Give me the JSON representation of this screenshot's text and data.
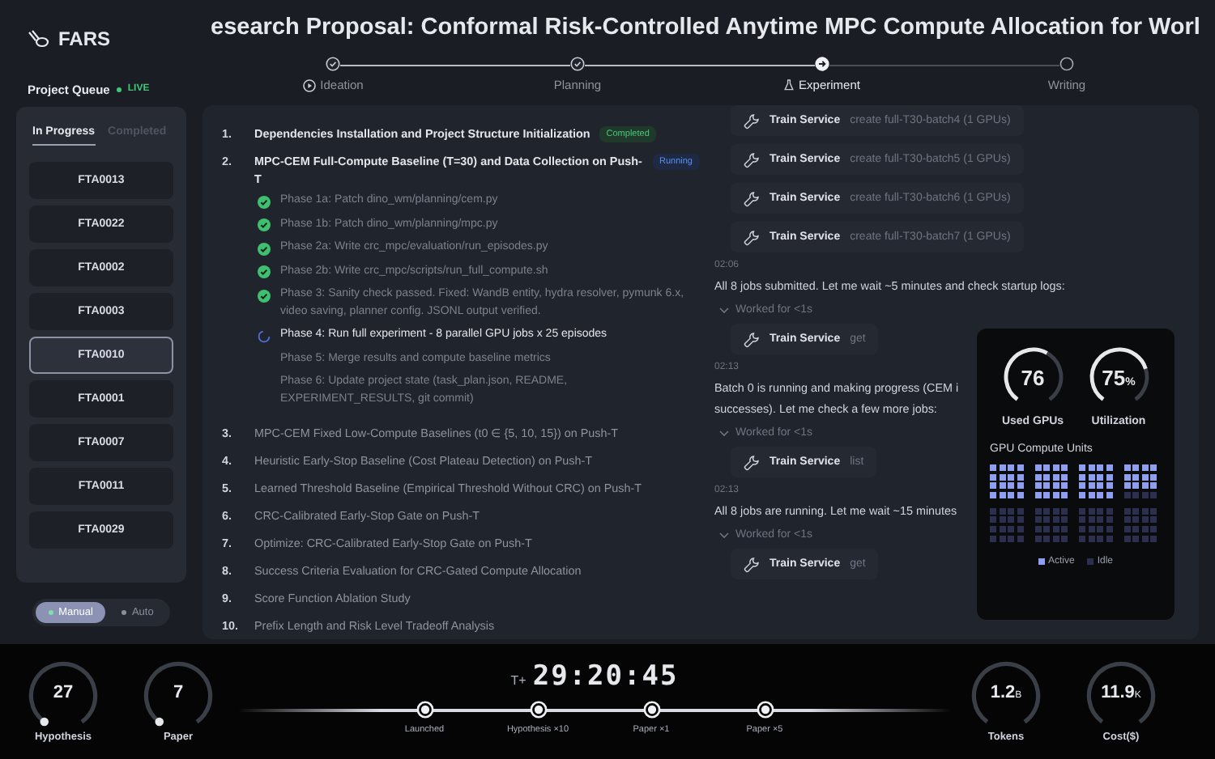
{
  "app": {
    "name": "FARS"
  },
  "queue": {
    "title": "Project Queue",
    "live": "LIVE",
    "tabs": [
      {
        "label": "In Progress",
        "selected": true
      },
      {
        "label": "Completed",
        "selected": false
      }
    ],
    "projects": [
      {
        "id": "FTA0013",
        "selected": false
      },
      {
        "id": "FTA0022",
        "selected": false
      },
      {
        "id": "FTA0002",
        "selected": false
      },
      {
        "id": "FTA0003",
        "selected": false
      },
      {
        "id": "FTA0010",
        "selected": true
      },
      {
        "id": "FTA0001",
        "selected": false
      },
      {
        "id": "FTA0007",
        "selected": false
      },
      {
        "id": "FTA0011",
        "selected": false
      },
      {
        "id": "FTA0029",
        "selected": false
      }
    ],
    "mode": [
      {
        "label": "Manual",
        "selected": true
      },
      {
        "label": "Auto",
        "selected": false
      }
    ]
  },
  "title": "esearch Proposal: Conformal Risk-Controlled Anytime MPC Compute Allocation for Worl",
  "stages": [
    {
      "label": "Ideation",
      "done": true,
      "current": false
    },
    {
      "label": "Planning",
      "done": true,
      "current": false
    },
    {
      "label": "Experiment",
      "done": false,
      "current": true
    },
    {
      "label": "Writing",
      "done": false,
      "current": false
    }
  ],
  "tasks": [
    {
      "number": "1.",
      "title": "Dependencies Installation and Project Structure Initialization",
      "active": true,
      "badge": {
        "text": "Completed",
        "kind": "completed"
      }
    },
    {
      "number": "2.",
      "title": "MPC-CEM Full-Compute Baseline (T=30) and Data Collection on Push-T",
      "active": true,
      "badge": {
        "text": "Running",
        "kind": "running"
      },
      "phases": [
        {
          "text": "Phase 1a: Patch dino_wm/planning/cem.py",
          "done": true,
          "running": false
        },
        {
          "text": "Phase 1b: Patch dino_wm/planning/mpc.py",
          "done": true,
          "running": false
        },
        {
          "text": "Phase 2a: Write crc_mpc/evaluation/run_episodes.py",
          "done": true,
          "running": false
        },
        {
          "text": "Phase 2b: Write crc_mpc/scripts/run_full_compute.sh",
          "done": true,
          "running": false
        },
        {
          "text": "Phase 3: Sanity check passed. Fixed: WandB entity, hydra resolver, pymunk 6.x, video saving, planner config. JSONL output verified.",
          "done": true,
          "running": false
        },
        {
          "text": "Phase 4: Run full experiment - 8 parallel GPU jobs x 25 episodes",
          "done": false,
          "running": true
        },
        {
          "text": "Phase 5: Merge results and compute baseline metrics",
          "done": false,
          "running": false
        },
        {
          "text": "Phase 6: Update project state (task_plan.json, README, EXPERIMENT_RESULTS, git commit)",
          "done": false,
          "running": false
        }
      ]
    },
    {
      "number": "3.",
      "title": "MPC-CEM Fixed Low-Compute Baselines (t0 ∈ {5, 10, 15}) on Push-T",
      "active": false
    },
    {
      "number": "4.",
      "title": "Heuristic Early-Stop Baseline (Cost Plateau Detection) on Push-T",
      "active": false
    },
    {
      "number": "5.",
      "title": "Learned Threshold Baseline (Empirical Threshold Without CRC) on Push-T",
      "active": false
    },
    {
      "number": "6.",
      "title": "CRC-Calibrated Early-Stop Gate on Push-T",
      "active": false
    },
    {
      "number": "7.",
      "title": "Optimize: CRC-Calibrated Early-Stop Gate on Push-T",
      "active": false
    },
    {
      "number": "8.",
      "title": "Success Criteria Evaluation for CRC-Gated Compute Allocation",
      "active": false
    },
    {
      "number": "9.",
      "title": "Score Function Ablation Study",
      "active": false
    },
    {
      "number": "10.",
      "title": "Prefix Length and Risk Level Tradeoff Analysis",
      "active": false
    }
  ],
  "log": [
    {
      "kind": "tool",
      "service": "Train Service",
      "args": "create full-T30-batch4 (1 GPUs)"
    },
    {
      "kind": "tool",
      "service": "Train Service",
      "args": "create full-T30-batch5 (1 GPUs)"
    },
    {
      "kind": "tool",
      "service": "Train Service",
      "args": "create full-T30-batch6 (1 GPUs)"
    },
    {
      "kind": "tool",
      "service": "Train Service",
      "args": "create full-T30-batch7 (1 GPUs)"
    },
    {
      "kind": "time",
      "text": "02:06"
    },
    {
      "kind": "message",
      "lines": [
        "All 8 jobs submitted. Let me wait ~5 minutes and check startup logs:"
      ]
    },
    {
      "kind": "worked",
      "text": "Worked for <1s"
    },
    {
      "kind": "tool",
      "service": "Train Service",
      "args": "get"
    },
    {
      "kind": "time",
      "text": "02:13"
    },
    {
      "kind": "message",
      "lines": [
        "Batch 0 is running and making progress (CEM i",
        "successes). Let me check a few more jobs:"
      ]
    },
    {
      "kind": "worked",
      "text": "Worked for <1s"
    },
    {
      "kind": "tool",
      "service": "Train Service",
      "args": "list"
    },
    {
      "kind": "time",
      "text": "02:13"
    },
    {
      "kind": "message",
      "lines": [
        "All 8 jobs are running. Let me wait ~15 minutes"
      ]
    },
    {
      "kind": "worked",
      "text": "Worked for <1s"
    },
    {
      "kind": "tool",
      "service": "Train Service",
      "args": "get"
    }
  ],
  "gpu": {
    "gauges": [
      {
        "value": "76",
        "label": "Used GPUs"
      },
      {
        "value": "75",
        "unit": "%",
        "label": "Utilization"
      }
    ],
    "title": "GPU Compute Units",
    "blocks": [
      {
        "cells": [
          true,
          true,
          true,
          true,
          true,
          true,
          true,
          true,
          true,
          true,
          true,
          true,
          true,
          true,
          true,
          true
        ]
      },
      {
        "cells": [
          true,
          true,
          true,
          true,
          true,
          true,
          true,
          true,
          true,
          true,
          true,
          true,
          true,
          true,
          true,
          true
        ]
      },
      {
        "cells": [
          true,
          true,
          true,
          true,
          true,
          true,
          true,
          true,
          true,
          true,
          true,
          true,
          true,
          true,
          true,
          true
        ]
      },
      {
        "cells": [
          true,
          true,
          true,
          true,
          true,
          true,
          true,
          true,
          true,
          true,
          true,
          true,
          false,
          false,
          false,
          false
        ]
      },
      {
        "cells": [
          false,
          false,
          false,
          false,
          false,
          false,
          false,
          false,
          false,
          false,
          false,
          false,
          false,
          false,
          false,
          false
        ]
      },
      {
        "cells": [
          false,
          false,
          false,
          false,
          false,
          false,
          false,
          false,
          false,
          false,
          false,
          false,
          false,
          false,
          false,
          false
        ]
      },
      {
        "cells": [
          false,
          false,
          false,
          false,
          false,
          false,
          false,
          false,
          false,
          false,
          false,
          false,
          false,
          false,
          false,
          false
        ]
      },
      {
        "cells": [
          false,
          false,
          false,
          false,
          false,
          false,
          false,
          false,
          false,
          false,
          false,
          false,
          false,
          false,
          false,
          false
        ]
      }
    ],
    "legend": [
      {
        "label": "Active",
        "kind": "active"
      },
      {
        "label": "Idle",
        "kind": "idle"
      }
    ]
  },
  "footer": {
    "left_gauges": [
      {
        "value": "27",
        "label": "Hypothesis"
      },
      {
        "value": "7",
        "label": "Paper"
      }
    ],
    "timer": {
      "prefix": "T+",
      "value": "29:20:45"
    },
    "milestones": [
      {
        "label": "Launched"
      },
      {
        "label": "Hypothesis ×10"
      },
      {
        "label": "Paper ×1"
      },
      {
        "label": "Paper ×5"
      }
    ],
    "right_gauges": [
      {
        "value": "1.2",
        "unit": "B",
        "label": "Tokens"
      },
      {
        "value": "11.9",
        "unit": "K",
        "label": "Cost($)"
      }
    ]
  }
}
